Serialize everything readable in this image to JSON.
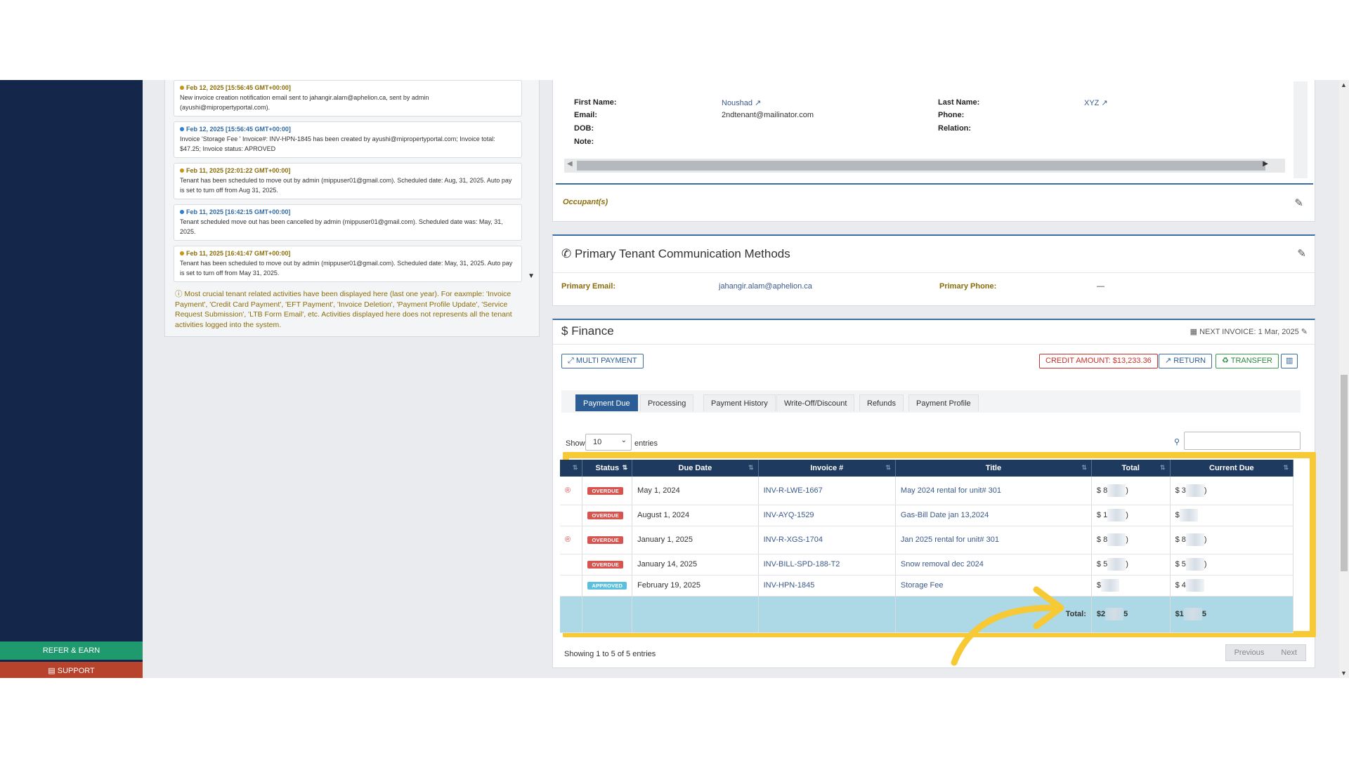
{
  "sidebar": {
    "refer_label": "REFER & EARN",
    "support_label": "SUPPORT"
  },
  "activity": {
    "items": [
      {
        "time": "Feb 12, 2025 [15:56:45 GMT+00:00]",
        "text": "New invoice creation notification email sent to jahangir.alam@aphelion.ca, sent by admin (ayushi@mipropertyportal.com).",
        "color": "orange"
      },
      {
        "time": "Feb 12, 2025 [15:56:45 GMT+00:00]",
        "text": "Invoice 'Storage Fee ' Invoice#: INV-HPN-1845 has been created by ayushi@mipropertyportal.com; Invoice total: $47.25; Invoice status: APROVED",
        "color": "blue"
      },
      {
        "time": "Feb 11, 2025 [22:01:22 GMT+00:00]",
        "text": "Tenant has been scheduled to move out by admin (mippuser01@gmail.com). Scheduled date: Aug, 31, 2025. Auto pay is set to turn off from Aug 31, 2025.",
        "color": "orange"
      },
      {
        "time": "Feb 11, 2025 [16:42:15 GMT+00:00]",
        "text": "Tenant scheduled move out has been cancelled by admin (mippuser01@gmail.com). Scheduled date was: May, 31, 2025.",
        "color": "blue"
      },
      {
        "time": "Feb 11, 2025 [16:41:47 GMT+00:00]",
        "text": "Tenant has been scheduled to move out by admin (mippuser01@gmail.com). Scheduled date: May, 31, 2025. Auto pay is set to turn off from May 31, 2025.",
        "color": "orange"
      }
    ],
    "note": "Most crucial tenant related activities have been displayed here (last one year). For eaxmple: 'Invoice Payment', 'Credit Card Payment', 'EFT Payment', 'Invoice Deletion', 'Payment Profile Update', 'Service Request Submission', 'LTB Form Email', etc. Activities displayed here does not represents all the tenant activities logged into the system."
  },
  "tenant": {
    "first_name_label": "First Name:",
    "first_name": "Noushad",
    "email_label": "Email:",
    "email": "2ndtenant@mailinator.com",
    "dob_label": "DOB:",
    "note_label": "Note:",
    "last_name_label": "Last Name:",
    "last_name": "XYZ",
    "phone_label": "Phone:",
    "relation_label": "Relation:",
    "occupants_label": "Occupant(s)"
  },
  "comm": {
    "title": "Primary Tenant Communication Methods",
    "email_label": "Primary Email:",
    "email": "jahangir.alam@aphelion.ca",
    "phone_label": "Primary Phone:",
    "phone": "—"
  },
  "finance": {
    "title": "Finance",
    "next_invoice": "NEXT INVOICE: 1 Mar, 2025",
    "multi_payment": "MULTI PAYMENT",
    "credit_amount": "CREDIT AMOUNT: $13,233.36",
    "return_label": "RETURN",
    "transfer_label": "TRANSFER",
    "tabs": [
      "Payment Due",
      "Processing",
      "Payment History",
      "Write-Off/Discount",
      "Refunds",
      "Payment Profile"
    ],
    "show_label": "Show",
    "page_size": "10",
    "entries_label": "entries",
    "columns": [
      "Status",
      "Due Date",
      "Invoice #",
      "Title",
      "Total",
      "Current Due"
    ],
    "rows": [
      {
        "status": "OVERDUE",
        "due": "May 1, 2024",
        "invoice": "INV-R-LWE-1667",
        "title": "May 2024 rental for unit# 301",
        "total": "$ 8",
        "current": "$ 3",
        "mark": "®"
      },
      {
        "status": "OVERDUE",
        "due": "August 1, 2024",
        "invoice": "INV-AYQ-1529",
        "title": "Gas-Bill Date jan 13,2024",
        "total": "$ 1",
        "current": "$",
        "mark": ""
      },
      {
        "status": "OVERDUE",
        "due": "January 1, 2025",
        "invoice": "INV-R-XGS-1704",
        "title": "Jan 2025 rental for unit# 301",
        "total": "$ 8",
        "current": "$ 8",
        "mark": "®"
      },
      {
        "status": "OVERDUE",
        "due": "January 14, 2025",
        "invoice": "INV-BILL-SPD-188-T2",
        "title": "Snow removal dec 2024",
        "total": "$ 5",
        "current": "$ 5",
        "mark": ""
      },
      {
        "status": "APPROVED",
        "due": "February 19, 2025",
        "invoice": "INV-HPN-1845",
        "title": "Storage Fee",
        "total": "$",
        "current": "$ 4",
        "mark": ""
      }
    ],
    "total_label": "Total:",
    "total_value": "$2",
    "current_total": "$1",
    "showing": "Showing 1 to 5 of 5 entries",
    "previous": "Previous",
    "next": "Next"
  },
  "colors": {
    "accent": "#2c5d94",
    "sidebar": "#14264a",
    "highlight": "#f7c934",
    "overdue": "#d9534f",
    "approved": "#5bc0de"
  }
}
